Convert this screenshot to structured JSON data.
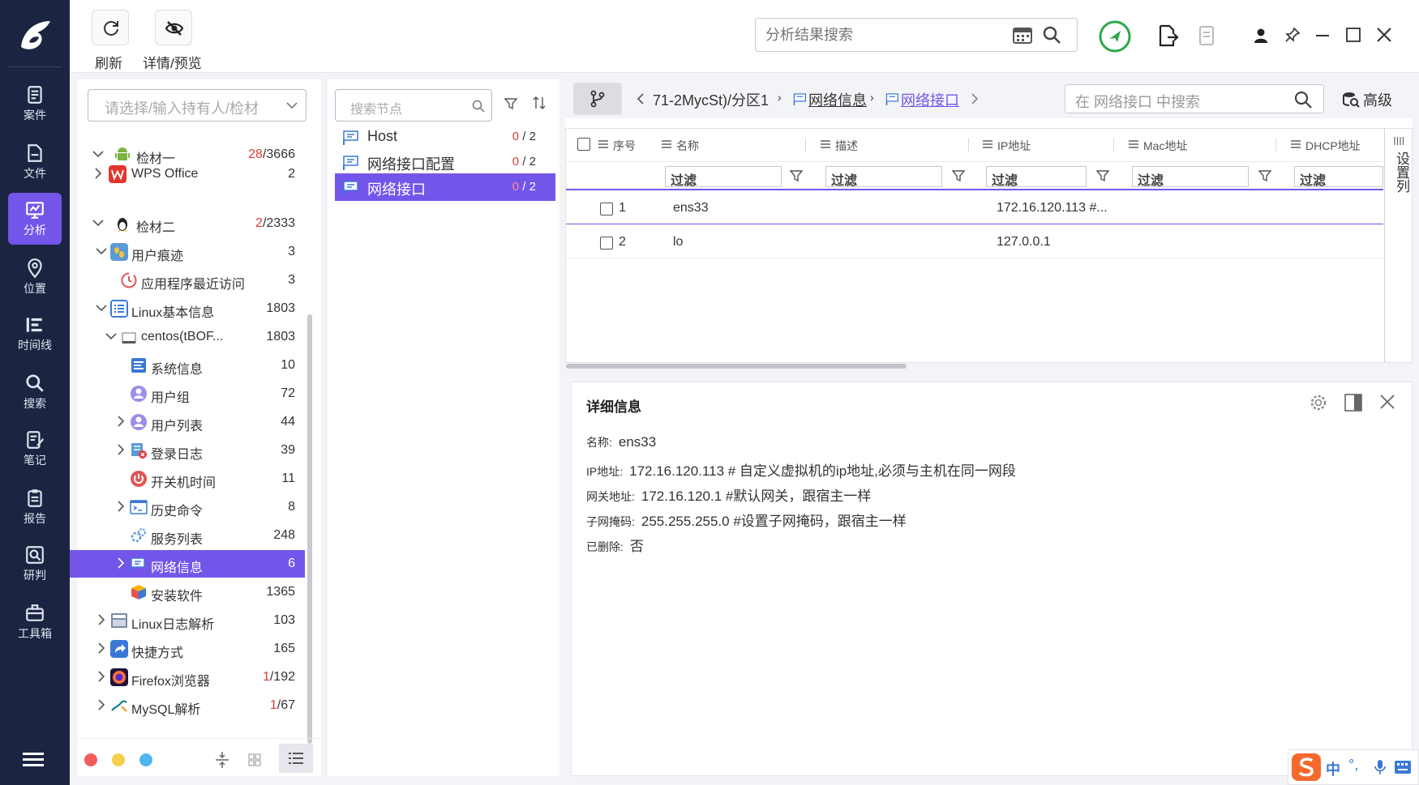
{
  "nav": {
    "items": [
      {
        "label": "案件",
        "icon": "case-icon"
      },
      {
        "label": "文件",
        "icon": "file-icon"
      },
      {
        "label": "分析",
        "icon": "analysis-icon"
      },
      {
        "label": "位置",
        "icon": "location-icon"
      },
      {
        "label": "时间线",
        "icon": "timeline-icon"
      },
      {
        "label": "搜索",
        "icon": "search-icon"
      },
      {
        "label": "笔记",
        "icon": "note-icon"
      },
      {
        "label": "报告",
        "icon": "report-icon"
      },
      {
        "label": "研判",
        "icon": "judge-icon"
      },
      {
        "label": "工具箱",
        "icon": "toolbox-icon"
      }
    ],
    "active": "分析"
  },
  "toolbar": {
    "refresh_label": "刷新",
    "preview_label": "详情/预览",
    "search_placeholder": "分析结果搜索"
  },
  "tree": {
    "select_placeholder": "请选择/输入持有人/检材",
    "rows": [
      {
        "label": "检材一",
        "count_red": "28",
        "count": "/3666"
      },
      {
        "label": "WPS Office",
        "count_red": "",
        "count": "2"
      },
      {
        "label": "检材二",
        "count_red": "2",
        "count": "/2333"
      },
      {
        "label": "用户痕迹",
        "count_red": "",
        "count": "3"
      },
      {
        "label": "应用程序最近访问",
        "count_red": "",
        "count": "3"
      },
      {
        "label": "Linux基本信息",
        "count_red": "",
        "count": "1803"
      },
      {
        "label": "centos(tBOF...",
        "count_red": "",
        "count": "1803"
      },
      {
        "label": "系统信息",
        "count_red": "",
        "count": "10"
      },
      {
        "label": "用户组",
        "count_red": "",
        "count": "72"
      },
      {
        "label": "用户列表",
        "count_red": "",
        "count": "44"
      },
      {
        "label": "登录日志",
        "count_red": "",
        "count": "39"
      },
      {
        "label": "开关机时间",
        "count_red": "",
        "count": "11"
      },
      {
        "label": "历史命令",
        "count_red": "",
        "count": "8"
      },
      {
        "label": "服务列表",
        "count_red": "",
        "count": "248"
      },
      {
        "label": "网络信息",
        "count_red": "",
        "count": "6"
      },
      {
        "label": "安装软件",
        "count_red": "",
        "count": "1365"
      },
      {
        "label": "Linux日志解析",
        "count_red": "",
        "count": "103"
      },
      {
        "label": "快捷方式",
        "count_red": "",
        "count": "165"
      },
      {
        "label": "Firefox浏览器",
        "count_red": "1",
        "count": "/192"
      },
      {
        "label": "MySQL解析",
        "count_red": "1",
        "count": "/67"
      }
    ]
  },
  "nodes": {
    "search_placeholder": "搜索节点",
    "rows": [
      {
        "label": "Host",
        "red": "0",
        "total": " / 2"
      },
      {
        "label": "网络接口配置",
        "red": "0",
        "total": " / 2"
      },
      {
        "label": "网络接口",
        "red": "0",
        "total": " / 2"
      }
    ]
  },
  "breadcrumb": {
    "items": [
      "71-2MycSt)/分区1",
      "网络信息",
      "网络接口"
    ],
    "search_placeholder": "在 网络接口 中搜索",
    "advanced_label": "高级"
  },
  "table": {
    "columns": [
      "序号",
      "名称",
      "描述",
      "IP地址",
      "Mac地址",
      "DHCP地址"
    ],
    "filter_label": "过滤",
    "rows": [
      {
        "index": "1",
        "name": "ens33",
        "desc": "",
        "ip": "172.16.120.113 #..."
      },
      {
        "index": "2",
        "name": "lo",
        "desc": "",
        "ip": "127.0.0.1"
      }
    ],
    "column_settings_label": "设置列"
  },
  "detail": {
    "title": "详细信息",
    "fields": [
      {
        "key": "名称:",
        "value": "ens33"
      },
      {
        "key": "IP地址:",
        "value": "172.16.120.113 # 自定义虚拟机的ip地址,必须与主机在同一网段"
      },
      {
        "key": "网关地址:",
        "value": "172.16.120.1 #默认网关，跟宿主一样"
      },
      {
        "key": "子网掩码:",
        "value": "255.255.255.0 #设置子网掩码，跟宿主一样"
      },
      {
        "key": "已删除:",
        "value": "否"
      }
    ]
  },
  "ime": {
    "mode": "中",
    "punct": "°,"
  },
  "colors": {
    "accent": "#7455ea",
    "nav_bg": "#1b2541",
    "count_red": "#e03a3a",
    "status_green": "#2ea84a"
  }
}
